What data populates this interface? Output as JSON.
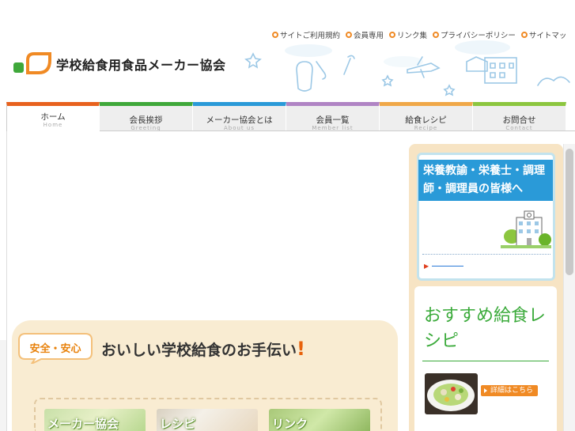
{
  "header": {
    "site_title": "学校給食用食品メーカー協会",
    "util_links": [
      "サイトご利用規約",
      "会員専用",
      "リンク集",
      "プライバシーポリシー",
      "サイトマッ"
    ]
  },
  "nav": {
    "tabs": [
      {
        "label": "ホーム",
        "sub": "Home",
        "color": "#e8621e"
      },
      {
        "label": "会長挨拶",
        "sub": "Greeting",
        "color": "#3fa83a"
      },
      {
        "label": "メーカー協会とは",
        "sub": "About us",
        "color": "#2a9ad8"
      },
      {
        "label": "会員一覧",
        "sub": "Member list",
        "color": "#b084c4"
      },
      {
        "label": "給食レシピ",
        "sub": "Recipe",
        "color": "#f0a848"
      },
      {
        "label": "お問合せ",
        "sub": "Contact",
        "color": "#8cc63f"
      }
    ]
  },
  "banner": {
    "badge": "安全・安心",
    "slogan": "おいしい学校給食のお手伝い",
    "slogan_mark": "!",
    "cards": [
      "メーカー協会",
      "レシピ",
      "リンク"
    ]
  },
  "sidebar": {
    "box_title": "栄養教諭・栄養士・調理師・調理員の皆様へ",
    "link_arrow": "▶",
    "recipe_title": "おすすめ給食レシピ",
    "recipe_button": "詳細はこちら"
  },
  "colors": {
    "accent_orange": "#f08a24",
    "sidebar_blue": "#2a9ad8",
    "recipe_green": "#3aaa3a",
    "banner_beige": "#f9ecd2"
  }
}
